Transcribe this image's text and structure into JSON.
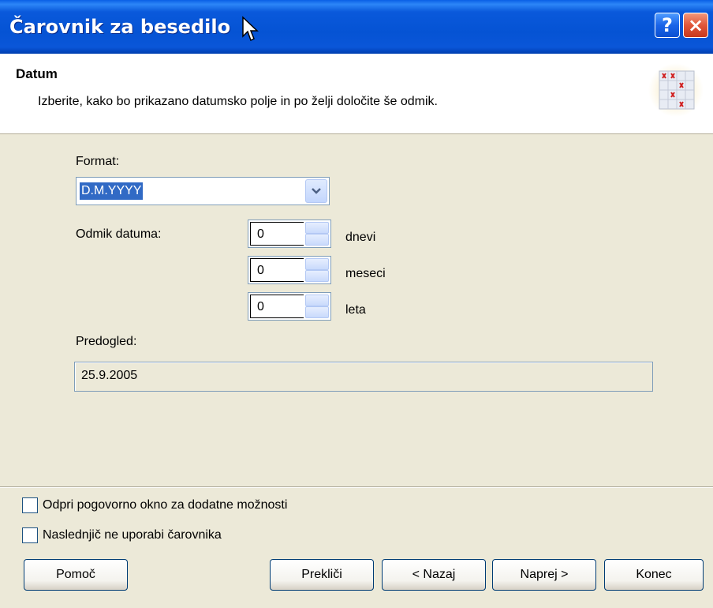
{
  "window": {
    "title": "Čarovnik za besedilo",
    "help_label": "?",
    "close_label": "×"
  },
  "header": {
    "title": "Datum",
    "description": "Izberite, kako bo prikazano datumsko polje in po želji določite še odmik."
  },
  "form": {
    "format_label": "Format:",
    "format_value": "D.M.YYYY",
    "offset_label": "Odmik datuma:",
    "offsets": [
      {
        "value": "0",
        "unit": "dnevi"
      },
      {
        "value": "0",
        "unit": "meseci"
      },
      {
        "value": "0",
        "unit": "leta"
      }
    ],
    "preview_label": "Predogled:",
    "preview_value": "25.9.2005"
  },
  "options": {
    "open_dialog_label": "Odpri pogovorno okno za dodatne možnosti",
    "open_dialog_checked": false,
    "no_wizard_label": "Naslednjič ne uporabi čarovnika",
    "no_wizard_checked": false
  },
  "buttons": {
    "help": "Pomoč",
    "cancel": "Prekliči",
    "back": "< Nazaj",
    "next": "Naprej >",
    "finish": "Konec"
  }
}
